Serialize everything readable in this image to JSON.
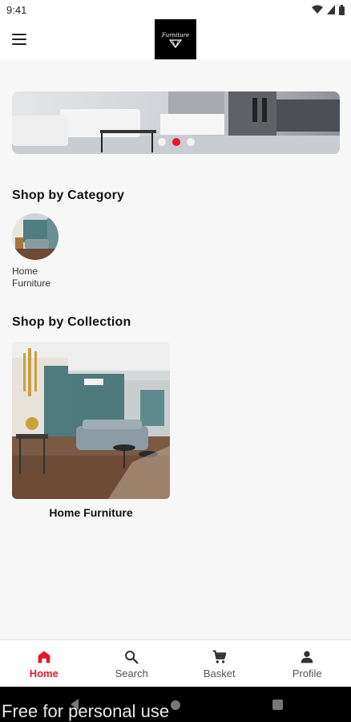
{
  "status_bar": {
    "time": "9:41"
  },
  "app_bar": {
    "logo_text": "Furniture"
  },
  "banner": {
    "dots": 3,
    "active_dot": 1
  },
  "category_section": {
    "title": "Shop by Category",
    "items": [
      {
        "label": "Home Furniture"
      }
    ]
  },
  "collection_section": {
    "title": "Shop by Collection",
    "items": [
      {
        "label": "Home Furniture"
      }
    ]
  },
  "bottom_nav": {
    "items": [
      {
        "label": "Home",
        "icon": "home-icon",
        "active": true
      },
      {
        "label": "Search",
        "icon": "search-icon",
        "active": false
      },
      {
        "label": "Basket",
        "icon": "cart-icon",
        "active": false
      },
      {
        "label": "Profile",
        "icon": "person-icon",
        "active": false
      }
    ]
  },
  "watermark": "Free for personal use",
  "colors": {
    "accent": "#e8162f",
    "background": "#f7f7f7"
  }
}
